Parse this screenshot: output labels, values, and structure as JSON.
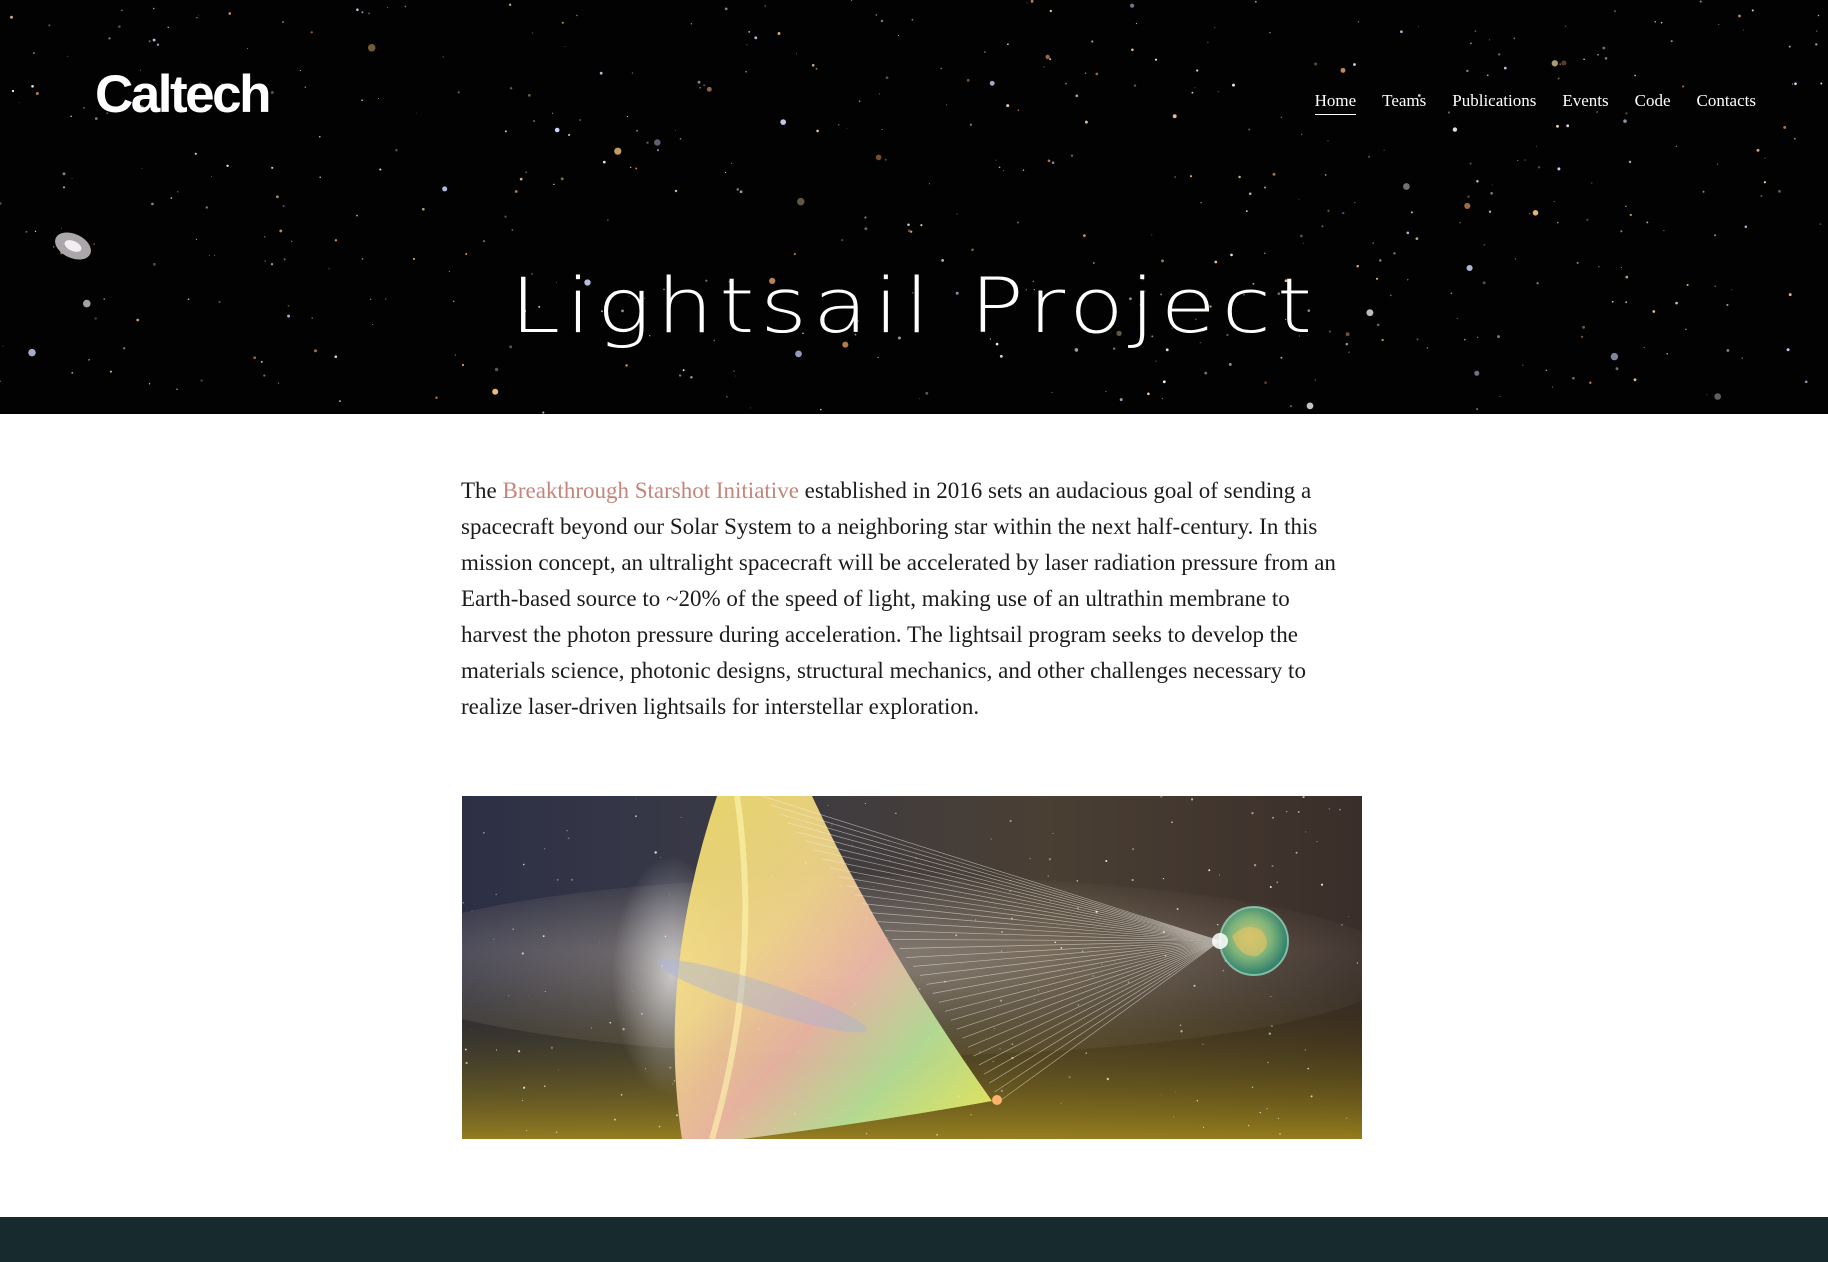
{
  "brand": {
    "logo_text": "Caltech"
  },
  "nav": {
    "items": [
      {
        "label": "Home",
        "active": true
      },
      {
        "label": "Teams",
        "active": false
      },
      {
        "label": "Publications",
        "active": false
      },
      {
        "label": "Events",
        "active": false
      },
      {
        "label": "Code",
        "active": false
      },
      {
        "label": "Contacts",
        "active": false
      }
    ]
  },
  "hero": {
    "title": "Lightsail Project"
  },
  "intro": {
    "lead": "The ",
    "link_text": "Breakthrough Starshot Initiative",
    "body": " established in 2016 sets an audacious goal of sending a spacecraft beyond our Solar System to a neighboring star within the next half-century. In this mission concept, an ultralight spacecraft will be accelerated by laser radiation pressure from an Earth-based source to ~20% of the speed of light, making use of an ultrathin membrane to harvest the photon pressure during acceleration. The lightsail program seeks to develop the materials science, photonic designs, structural mechanics, and other challenges necessary to realize laser-driven lightsails for interstellar exploration."
  },
  "colors": {
    "link": "#c4857b",
    "hero_background": "#020203",
    "footer_background": "#172a2e",
    "text": "#1b1b1b"
  }
}
